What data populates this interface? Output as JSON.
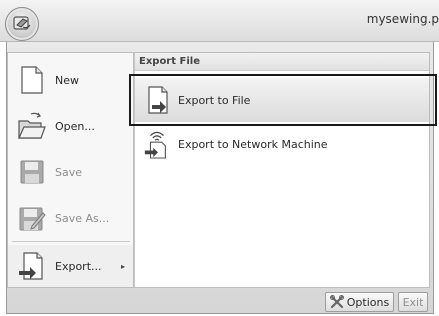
{
  "window": {
    "title": "mysewing.p"
  },
  "left_menu": {
    "items": [
      {
        "id": "new",
        "label": "New",
        "icon": "new-document-icon",
        "disabled": false
      },
      {
        "id": "open",
        "label": "Open...",
        "icon": "open-folder-icon",
        "disabled": false
      },
      {
        "id": "save",
        "label": "Save",
        "icon": "save-disk-icon",
        "disabled": true
      },
      {
        "id": "save_as",
        "label": "Save As...",
        "icon": "save-as-icon",
        "disabled": true
      },
      {
        "id": "export",
        "label": "Export...",
        "icon": "export-icon",
        "disabled": false,
        "has_submenu": true,
        "submenu_arrow": "▸"
      }
    ]
  },
  "export_panel": {
    "header": "Export File",
    "items": [
      {
        "id": "export_to_file",
        "label": "Export to File",
        "icon": "export-to-file-icon",
        "highlighted": true
      },
      {
        "id": "export_to_network",
        "label": "Export to Network Machine",
        "icon": "network-machine-icon",
        "highlighted": false
      }
    ]
  },
  "footer": {
    "options_label": "Options",
    "options_icon": "tools-icon",
    "exit_label": "Exit",
    "exit_disabled": true
  },
  "colors": {
    "frame_background": "#d6d6d6",
    "highlight": "#dcdcdc",
    "focus_outline": "#1a1a1a",
    "disabled_text": "#8d8d8d"
  }
}
